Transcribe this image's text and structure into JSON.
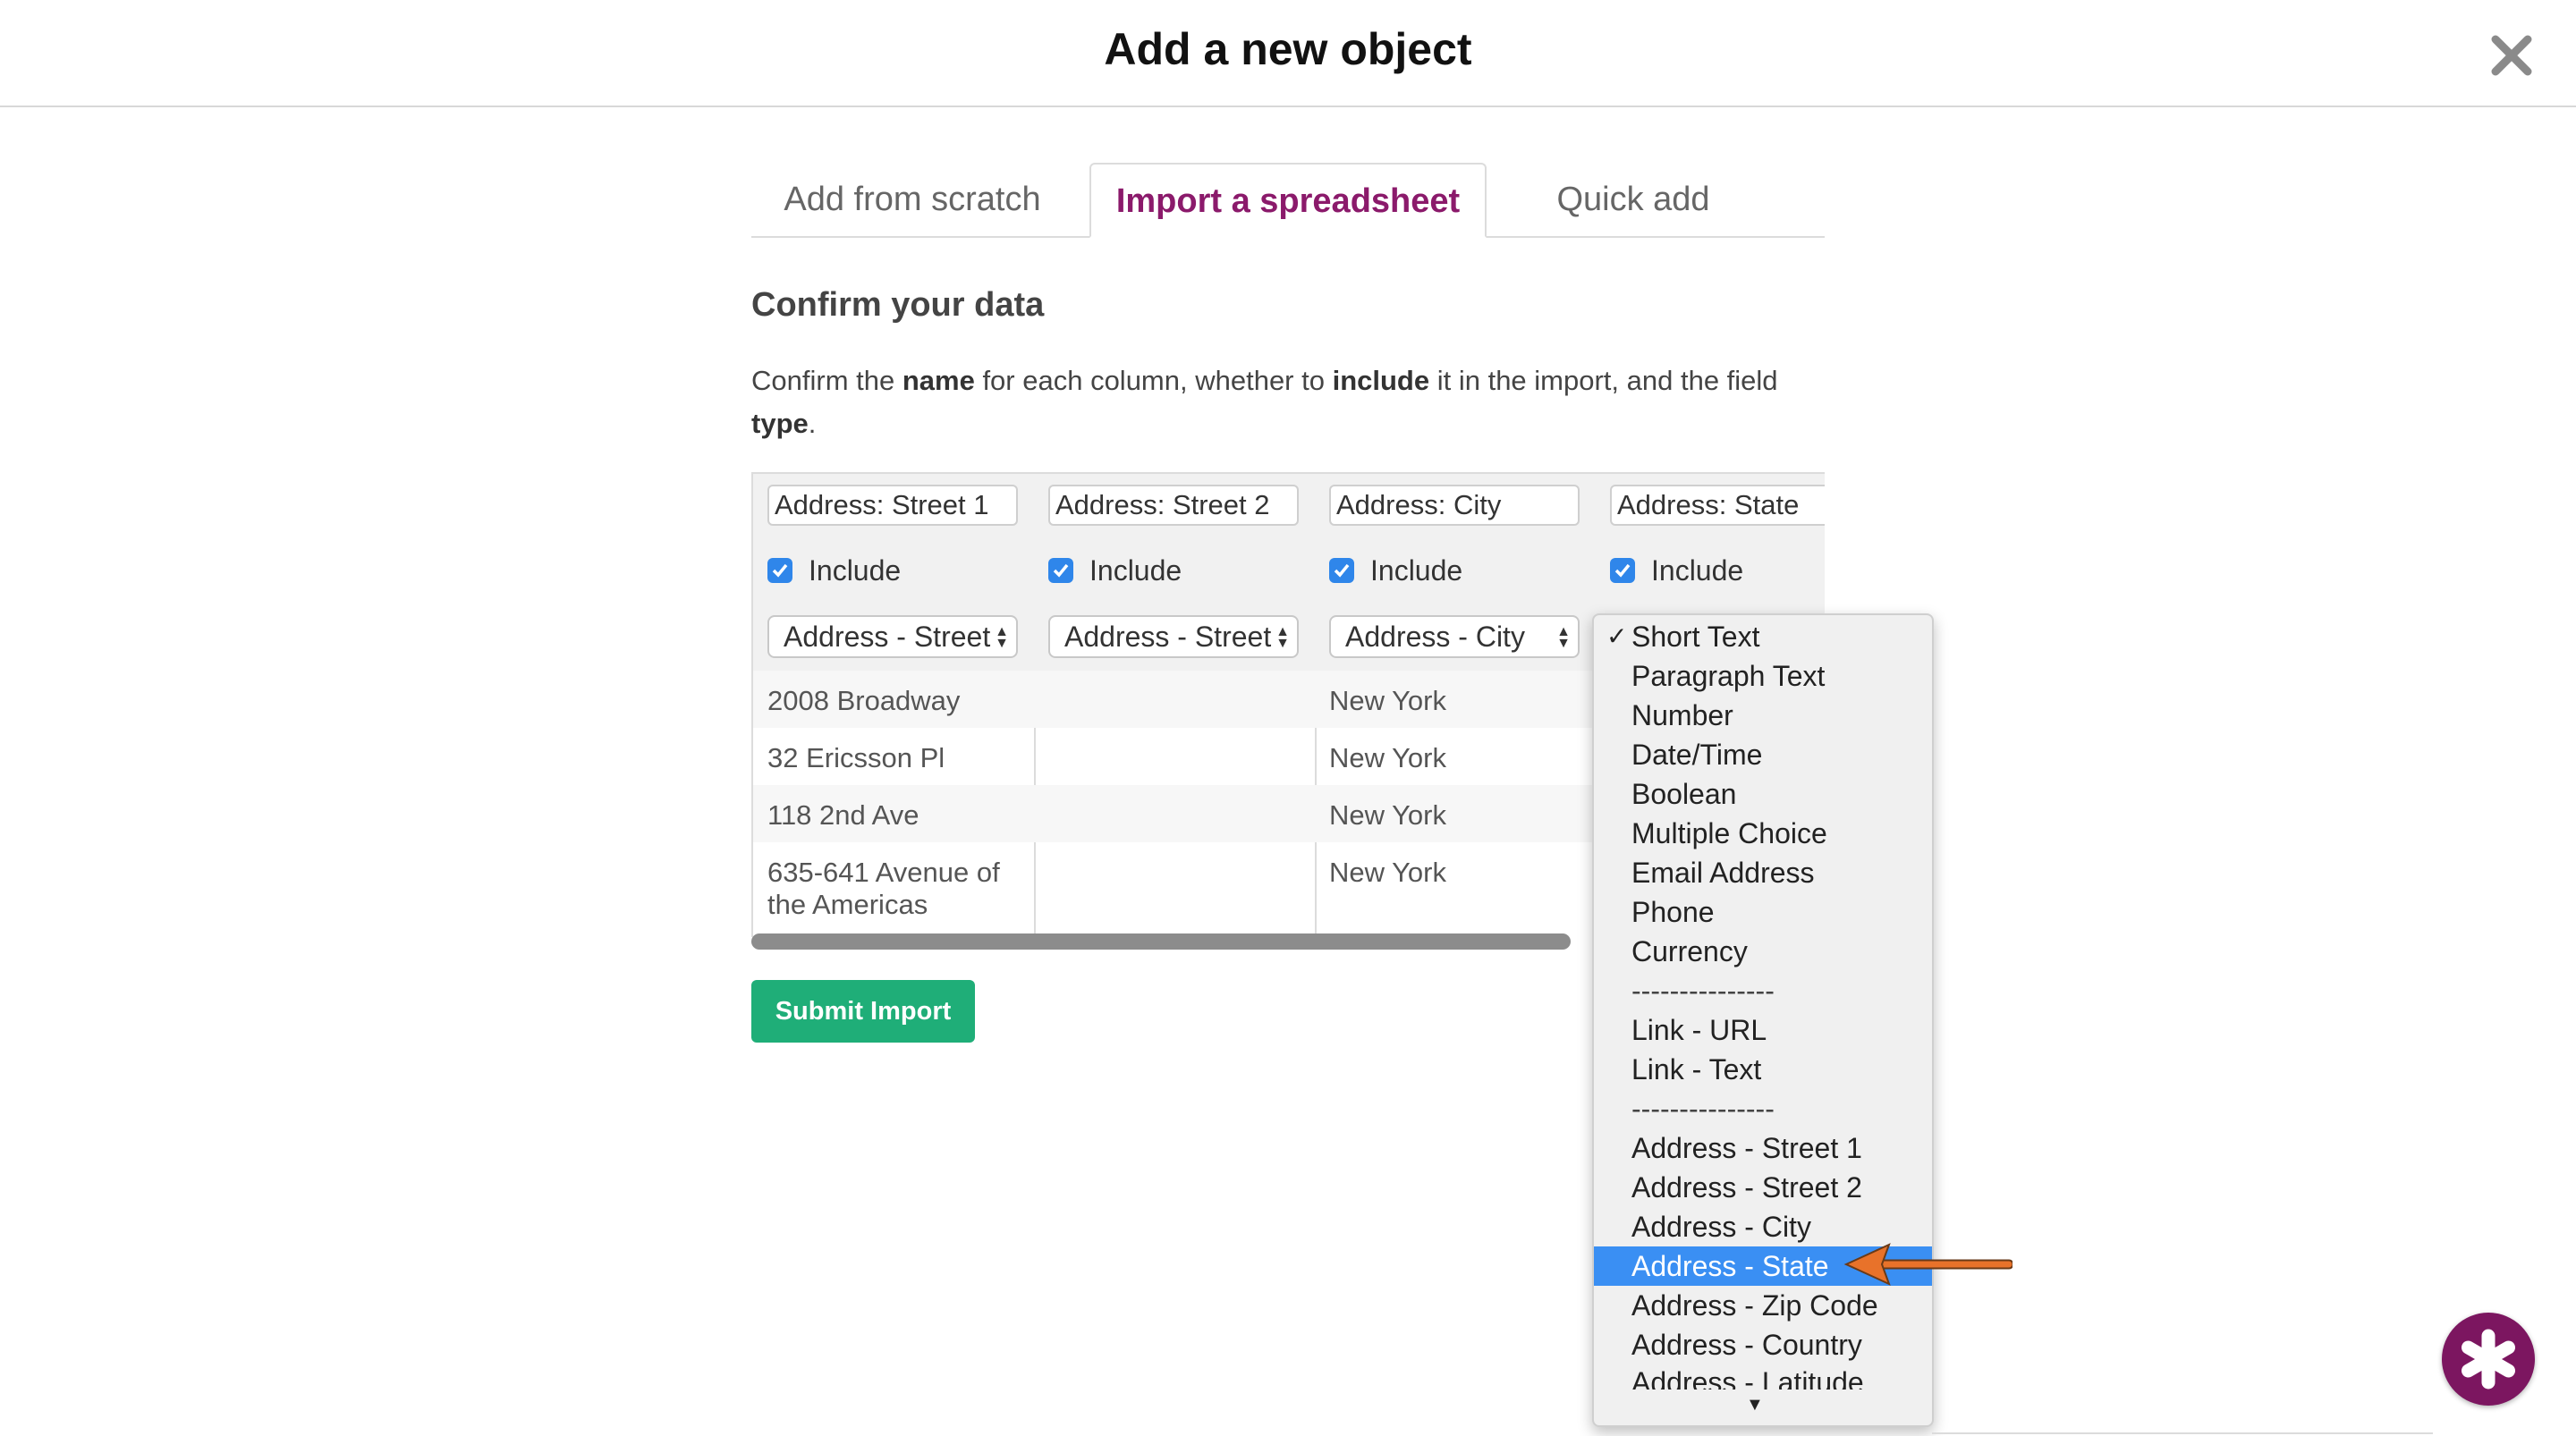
{
  "modal": {
    "title": "Add a new object"
  },
  "tabs": [
    {
      "label": "Add from scratch",
      "active": false
    },
    {
      "label": "Import a spreadsheet",
      "active": true
    },
    {
      "label": "Quick add",
      "active": false
    }
  ],
  "section": {
    "title": "Confirm your data",
    "description": {
      "part1": "Confirm the ",
      "bold1": "name",
      "part2": " for each column, whether to ",
      "bold2": "include",
      "part3": " it in the import, and the field ",
      "bold3": "type",
      "part4": "."
    }
  },
  "columns": [
    {
      "name": "Address: Street 1",
      "include_label": "Include",
      "included": true,
      "type": "Address - Street",
      "cells": [
        "2008 Broadway",
        "32 Ericsson Pl",
        "118 2nd Ave",
        "635-641 Avenue of the Americas"
      ]
    },
    {
      "name": "Address: Street 2",
      "include_label": "Include",
      "included": true,
      "type": "Address - Street",
      "cells": [
        "",
        "",
        "",
        ""
      ]
    },
    {
      "name": "Address: City",
      "include_label": "Include",
      "included": true,
      "type": "Address - City",
      "cells": [
        "New York",
        "New York",
        "New York",
        "New York"
      ]
    },
    {
      "name": "Address: State",
      "include_label": "Include",
      "included": true,
      "type": "",
      "cells": [
        "",
        "",
        "",
        ""
      ]
    }
  ],
  "submit_label": "Submit Import",
  "dropdown": {
    "checked_option": "Short Text",
    "highlighted_option": "Address - State",
    "options": [
      "Short Text",
      "Paragraph Text",
      "Number",
      "Date/Time",
      "Boolean",
      "Multiple Choice",
      "Email Address",
      "Phone",
      "Currency",
      "---------------",
      "Link - URL",
      "Link - Text",
      "---------------",
      "Address - Street 1",
      "Address - Street 2",
      "Address - City",
      "Address - State",
      "Address - Zip Code",
      "Address - Country",
      "Address - Latitude"
    ]
  },
  "colors": {
    "active_tab": "#8b1a6b",
    "submit": "#1fae78",
    "checkbox": "#2f86ea",
    "highlight": "#3a8ff3",
    "annotation_arrow": "#e8722a",
    "help_button": "#7c1660"
  },
  "icons": {
    "close": "close-icon",
    "help": "asterisk-icon",
    "check": "check-icon",
    "select_arrows": "updown-arrows-icon",
    "scroll_down": "triangle-down-icon"
  }
}
